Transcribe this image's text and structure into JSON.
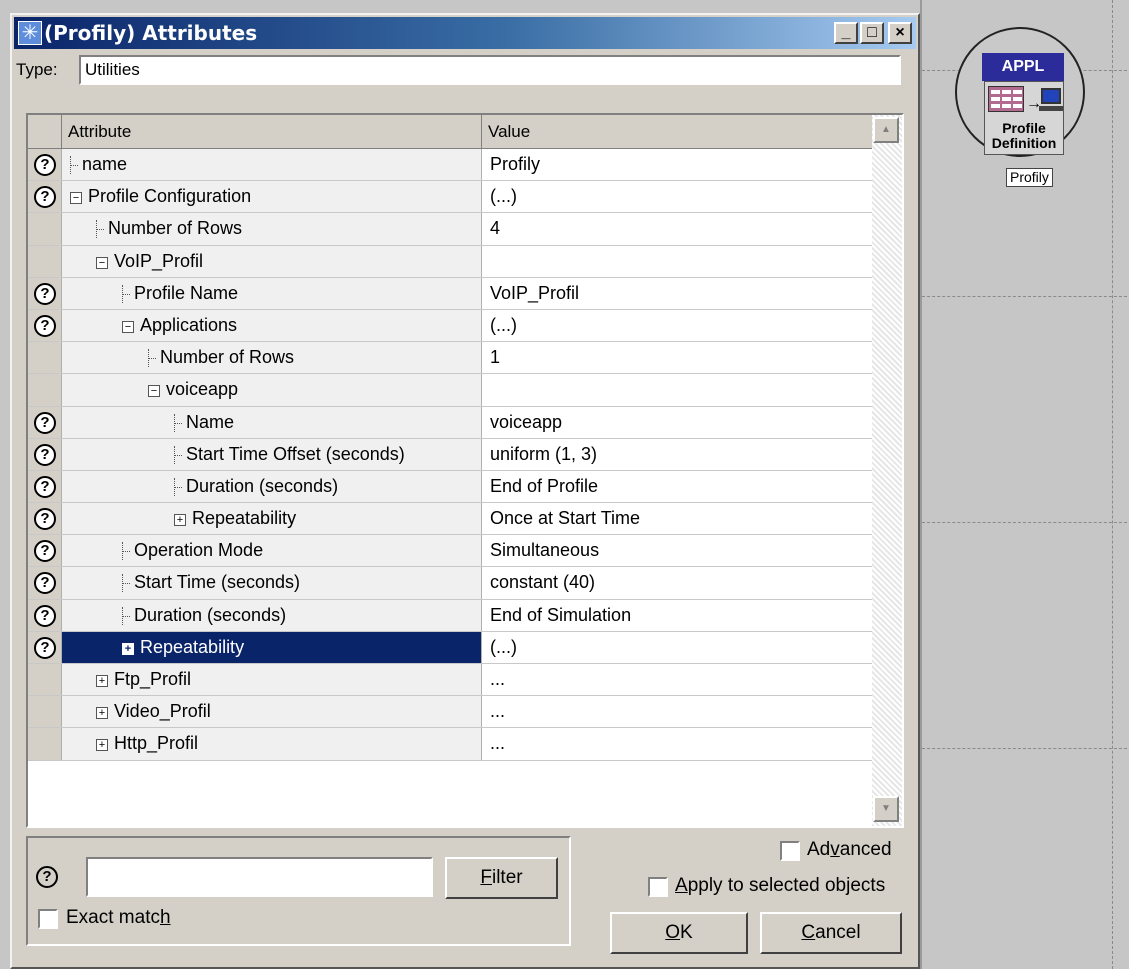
{
  "window": {
    "title": "(Profily) Attributes",
    "minimize_label": "_",
    "maximize_label": "□",
    "close_label": "×"
  },
  "type_row": {
    "label": "Type:",
    "value": "Utilities"
  },
  "table": {
    "headers": {
      "attribute": "Attribute",
      "value": "Value"
    },
    "rows": [
      {
        "help": true,
        "level": 0,
        "toggle": "",
        "label": "name",
        "value": "Profily"
      },
      {
        "help": true,
        "level": 0,
        "toggle": "−",
        "label": "Profile Configuration",
        "value": "(...)"
      },
      {
        "help": false,
        "level": 1,
        "toggle": "",
        "label": "Number of Rows",
        "value": "4"
      },
      {
        "help": false,
        "level": 1,
        "toggle": "−",
        "label": "VoIP_Profil",
        "value": ""
      },
      {
        "help": true,
        "level": 2,
        "toggle": "",
        "label": "Profile Name",
        "value": "VoIP_Profil"
      },
      {
        "help": true,
        "level": 2,
        "toggle": "−",
        "label": "Applications",
        "value": "(...)"
      },
      {
        "help": false,
        "level": 3,
        "toggle": "",
        "label": "Number of Rows",
        "value": "1"
      },
      {
        "help": false,
        "level": 3,
        "toggle": "−",
        "label": "voiceapp",
        "value": ""
      },
      {
        "help": true,
        "level": 4,
        "toggle": "",
        "label": "Name",
        "value": "voiceapp"
      },
      {
        "help": true,
        "level": 4,
        "toggle": "",
        "label": "Start Time Offset (seconds)",
        "value": "uniform (1, 3)"
      },
      {
        "help": true,
        "level": 4,
        "toggle": "",
        "label": "Duration (seconds)",
        "value": "End of Profile"
      },
      {
        "help": true,
        "level": 4,
        "toggle": "+",
        "label": "Repeatability",
        "value": "Once at Start Time"
      },
      {
        "help": true,
        "level": 2,
        "toggle": "",
        "label": "Operation Mode",
        "value": "Simultaneous"
      },
      {
        "help": true,
        "level": 2,
        "toggle": "",
        "label": "Start Time (seconds)",
        "value": "constant (40)"
      },
      {
        "help": true,
        "level": 2,
        "toggle": "",
        "label": "Duration (seconds)",
        "value": "End of Simulation"
      },
      {
        "help": true,
        "level": 2,
        "toggle": "+",
        "label": "Repeatability",
        "value": "(...)",
        "selected": true
      },
      {
        "help": false,
        "level": 1,
        "toggle": "+",
        "label": "Ftp_Profil",
        "value": "..."
      },
      {
        "help": false,
        "level": 1,
        "toggle": "+",
        "label": "Video_Profil",
        "value": "..."
      },
      {
        "help": false,
        "level": 1,
        "toggle": "+",
        "label": "Http_Profil",
        "value": "..."
      }
    ]
  },
  "filter": {
    "input_value": "",
    "button_pre": "",
    "button_mnemonic": "F",
    "button_post": "ilter",
    "exact_pre": "Exact matc",
    "exact_mnemonic": "h",
    "exact_post": ""
  },
  "options": {
    "advanced_pre": "Ad",
    "advanced_mnemonic": "v",
    "advanced_post": "anced",
    "apply_pre": "",
    "apply_mnemonic": "A",
    "apply_post": "pply to selected objects"
  },
  "buttons": {
    "ok_mnemonic": "O",
    "ok_post": "K",
    "cancel_mnemonic": "C",
    "cancel_post": "ancel"
  },
  "canvas_node": {
    "header": "APPL",
    "line1": "Profile",
    "line2": "Definition",
    "name_label": "Profily"
  },
  "colors": {
    "selection": "#0a246a",
    "dialog_face": "#d4d0c8",
    "node_header": "#2b2b9a"
  }
}
